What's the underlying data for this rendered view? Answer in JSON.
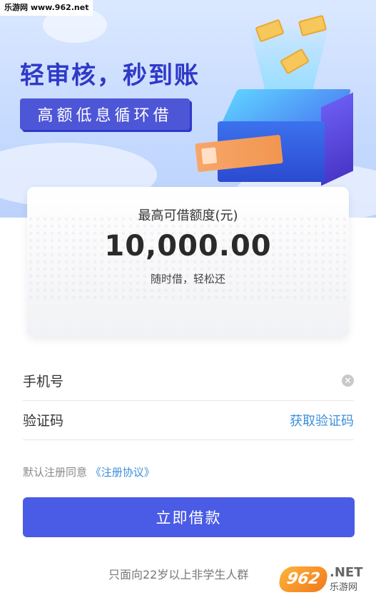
{
  "watermark": {
    "top": "乐游网 www.962.net",
    "badge": "962",
    "net": ".NET",
    "site": "乐游网"
  },
  "hero": {
    "slogan": "轻审核，秒到账",
    "sub_slogan": "高额低息循环借"
  },
  "amount_card": {
    "label": "最高可借额度(元)",
    "value": "10,000.00",
    "note": "随时借，轻松还"
  },
  "form": {
    "phone": {
      "label": "手机号",
      "value": "",
      "placeholder": "",
      "clear_icon": "clear-icon"
    },
    "code": {
      "label": "验证码",
      "value": "",
      "placeholder": "",
      "get_code_label": "获取验证码"
    }
  },
  "agreement": {
    "prefix": "默认注册同意",
    "link": "《注册协议》"
  },
  "submit": {
    "label": "立即借款"
  },
  "footer": {
    "note": "只面向22岁以上非学生人群"
  },
  "colors": {
    "primary": "#4a5be6",
    "link": "#3c8fdc",
    "slogan": "#2f39c8"
  }
}
